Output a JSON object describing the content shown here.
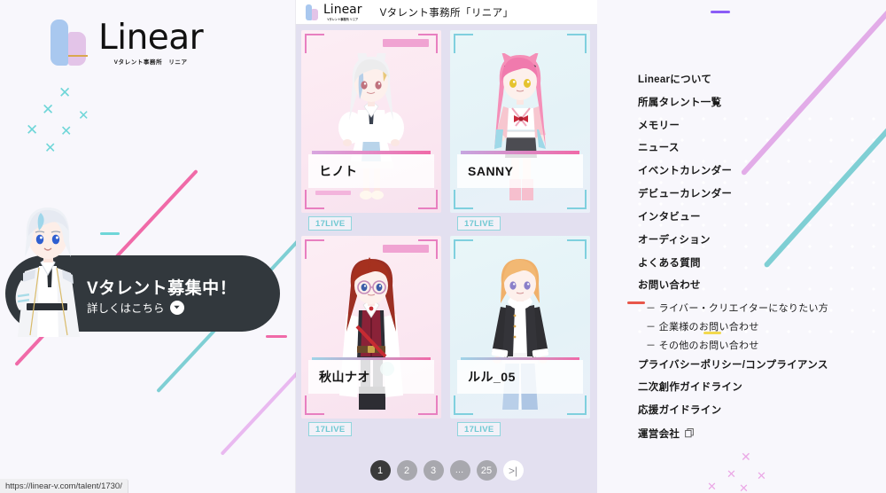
{
  "brand": {
    "wordmark": "Linear",
    "subtitle": "Vタレント事務所　リニア"
  },
  "cta": {
    "title": "Vタレント募集中！",
    "subtitle": "詳しくはこちら",
    "arrow_icon": "arrow-down-circle-icon"
  },
  "status_bar": {
    "url": "https://linear-v.com/talent/1730/"
  },
  "center": {
    "logo_wordmark": "Linear",
    "logo_subtitle": "Vタレント事務所 リニア",
    "site_title": "Vタレント事務所「リニア」",
    "cards": [
      {
        "name": "ヒノト",
        "badge": "17LIVE",
        "theme": "pink"
      },
      {
        "name": "SANNY",
        "badge": "17LIVE",
        "theme": "blue"
      },
      {
        "name": "秋山ナオ",
        "badge": "17LIVE",
        "theme": "pink"
      },
      {
        "name": "ルル_05",
        "badge": "17LIVE",
        "theme": "blue"
      }
    ],
    "pagination": {
      "pages": [
        "1",
        "2",
        "3",
        "…",
        "25"
      ],
      "active": "1",
      "next_label": ">|"
    }
  },
  "menu": {
    "items": [
      {
        "label": "Linearについて",
        "sub": false
      },
      {
        "label": "所属タレント一覧",
        "sub": false
      },
      {
        "label": "メモリー",
        "sub": false
      },
      {
        "label": "ニュース",
        "sub": false
      },
      {
        "label": "イベントカレンダー",
        "sub": false
      },
      {
        "label": "デビューカレンダー",
        "sub": false
      },
      {
        "label": "インタビュー",
        "sub": false
      },
      {
        "label": "オーディション",
        "sub": false
      },
      {
        "label": "よくある質問",
        "sub": false
      },
      {
        "label": "お問い合わせ",
        "sub": false
      },
      {
        "label": "－ ライバー・クリエイターになりたい方",
        "sub": true
      },
      {
        "label": "－ 企業様のお問い合わせ",
        "sub": true
      },
      {
        "label": "－ その他のお問い合わせ",
        "sub": true
      },
      {
        "label": "プライバシーポリシー/コンプライアンス",
        "sub": false
      },
      {
        "label": "二次創作ガイドライン",
        "sub": false
      },
      {
        "label": "応援ガイドライン",
        "sub": false
      },
      {
        "label": "運営会社",
        "sub": false,
        "icon": "external-link-icon"
      }
    ]
  },
  "colors": {
    "page_bg": "#f8f7fc",
    "center_bg": "#e3e0f0",
    "accent_pink": "#e87fc0",
    "accent_teal": "#7fd0de",
    "accent_lilac": "#e0aee8",
    "accent_purple": "#8b5cf6",
    "cta_bg": "#32383d",
    "pagination_active": "#3a3a3a"
  }
}
